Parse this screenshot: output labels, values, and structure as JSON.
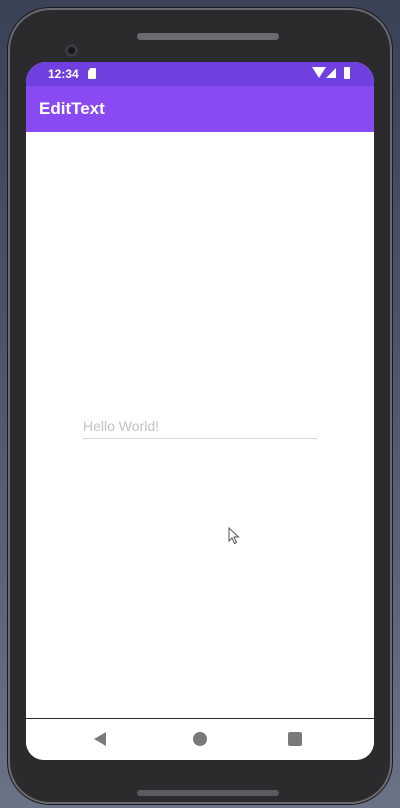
{
  "status_bar": {
    "time": "12:34",
    "icons": [
      "sd-card-icon",
      "wifi-icon",
      "signal-icon",
      "battery-icon"
    ]
  },
  "app_bar": {
    "title": "EditText",
    "color": "#8a4af3",
    "status_color": "#6f3fe0"
  },
  "edit_text": {
    "placeholder": "Hello World!",
    "value": ""
  },
  "nav_bar": {
    "buttons": [
      "back-icon",
      "home-icon",
      "recents-icon"
    ]
  }
}
